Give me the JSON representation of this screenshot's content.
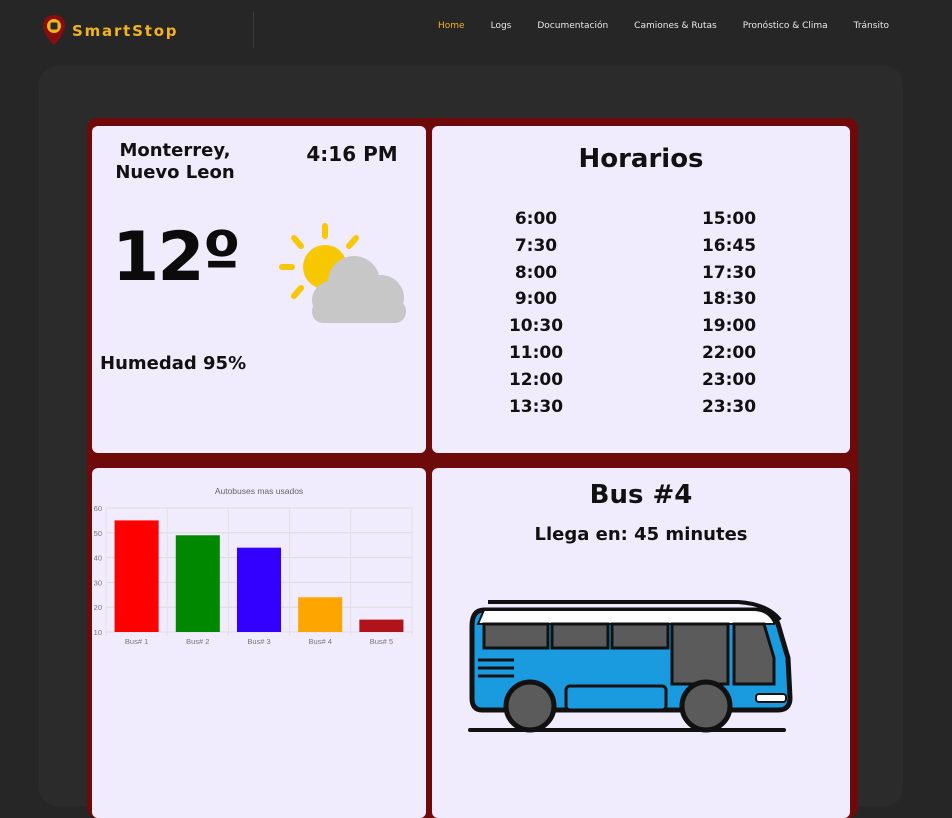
{
  "header": {
    "brand": "SmartStop",
    "nav": [
      {
        "label": "Home",
        "active": true
      },
      {
        "label": "Logs",
        "active": false
      },
      {
        "label": "Documentación",
        "active": false
      },
      {
        "label": "Camiones & Rutas",
        "active": false
      },
      {
        "label": "Pronóstico & Clima",
        "active": false
      },
      {
        "label": "Tránsito",
        "active": false
      }
    ]
  },
  "weather": {
    "city_line1": "Monterrey,",
    "city_line2": "Nuevo Leon",
    "time": "4:16 PM",
    "temperature": "12º",
    "icon": "partly-cloudy-icon",
    "humidity": "Humedad 95%"
  },
  "horarios": {
    "title": "Horarios",
    "left": [
      "6:00",
      "7:30",
      "8:00",
      "9:00",
      "10:30",
      "11:00",
      "12:00",
      "13:30"
    ],
    "right": [
      "15:00",
      "16:45",
      "17:30",
      "18:30",
      "19:00",
      "22:00",
      "23:00",
      "23:30"
    ]
  },
  "chart_data": {
    "type": "bar",
    "title": "Autobuses mas usados",
    "categories": [
      "Bus# 1",
      "Bus# 2",
      "Bus# 3",
      "Bus# 4",
      "Bus# 5"
    ],
    "values": [
      55,
      49,
      44,
      24,
      15
    ],
    "colors": [
      "#ff0000",
      "#008800",
      "#3300ff",
      "#ffa500",
      "#b0141a"
    ],
    "ylim": [
      10,
      60
    ],
    "yticks": [
      10,
      20,
      30,
      40,
      50,
      60
    ],
    "grid": true,
    "xlabel": "",
    "ylabel": ""
  },
  "bus": {
    "title": "Bus #4",
    "eta_label": "Llega en: 45 minutes",
    "icon": "bus-icon"
  },
  "colors": {
    "accent": "#f4b21c",
    "frame": "#6e0a0a",
    "panel": "#f0ecfd",
    "bus_body": "#1a9be0"
  }
}
